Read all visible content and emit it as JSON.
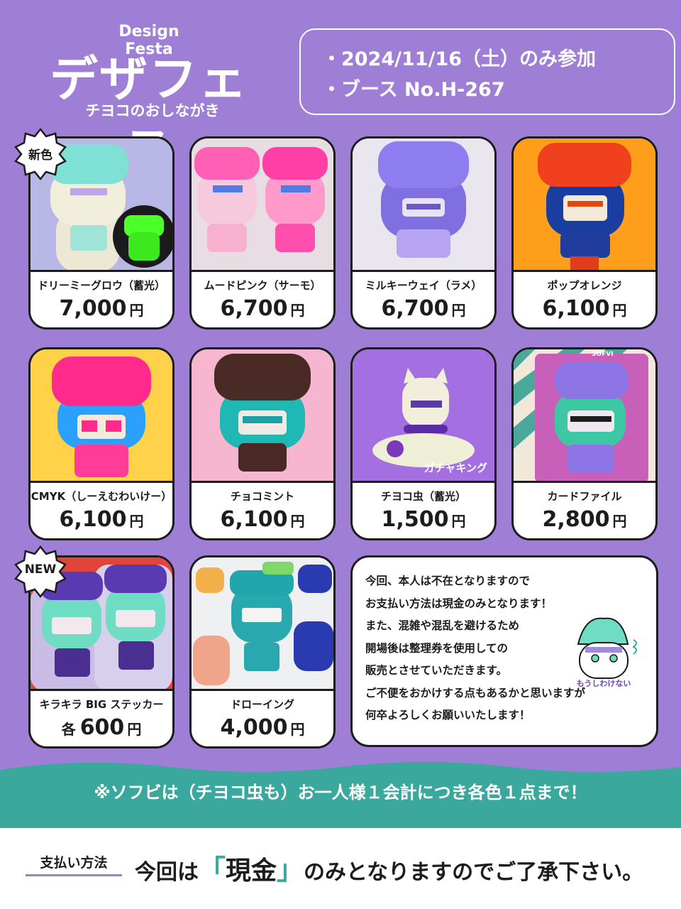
{
  "header": {
    "title_small": "Design Festa",
    "title_big": "デザフェス",
    "subtitle": "チヨコのおしながき",
    "info": [
      "・2024/11/16（土）のみ参加",
      "・ブース No.H-267"
    ]
  },
  "badges": {
    "new_color": "新色",
    "new": "NEW"
  },
  "products": [
    {
      "name": "ドリーミーグロウ（蓄光）",
      "price": "7,000",
      "yen": "円"
    },
    {
      "name": "ムードピンク（サーモ）",
      "price": "6,700",
      "yen": "円"
    },
    {
      "name": "ミルキーウェイ（ラメ）",
      "price": "6,700",
      "yen": "円"
    },
    {
      "name": "ポップオレンジ",
      "price": "6,100",
      "yen": "円"
    },
    {
      "name": "CMYK（しーえむわいけー）",
      "price": "6,100",
      "yen": "円"
    },
    {
      "name": "チョコミント",
      "price": "6,100",
      "yen": "円"
    },
    {
      "name": "チヨコ虫（蓄光）",
      "price": "1,500",
      "yen": "円",
      "photo_label": "ガチャキング"
    },
    {
      "name": "カードファイル",
      "price": "2,800",
      "yen": "円",
      "photo_label": "SOFVI"
    },
    {
      "name": "キラキラ BIG ステッカー",
      "prefix": "各",
      "price": "600",
      "yen": "円"
    },
    {
      "name": "ドローイング",
      "price": "4,000",
      "yen": "円"
    }
  ],
  "notice": {
    "lines": [
      "今回、本人は不在となりますので",
      "お支払い方法は現金のみとなります！",
      "また、混雑や混乱を避けるため",
      "開場後は整理券を使用しての",
      "販売とさせていただきます。",
      "ご不便をおかけする点もあるかと思いますが",
      "何卒よろしくお願いいたします！"
    ],
    "mascot_text": "もうしわけない"
  },
  "banner": "※ソフビは（チヨコ虫も）お一人様１会計につき各色１点まで！",
  "footer": {
    "label": "支払い方法",
    "text_before": "今回は",
    "bracket_open": "「",
    "cash": "現金",
    "bracket_close": "」",
    "text_after": "のみとなりますのでご了承下さい。"
  },
  "colors": {
    "background": "#9f7fd6",
    "banner": "#3aa89d",
    "accent_bracket": "#3aa89d"
  }
}
